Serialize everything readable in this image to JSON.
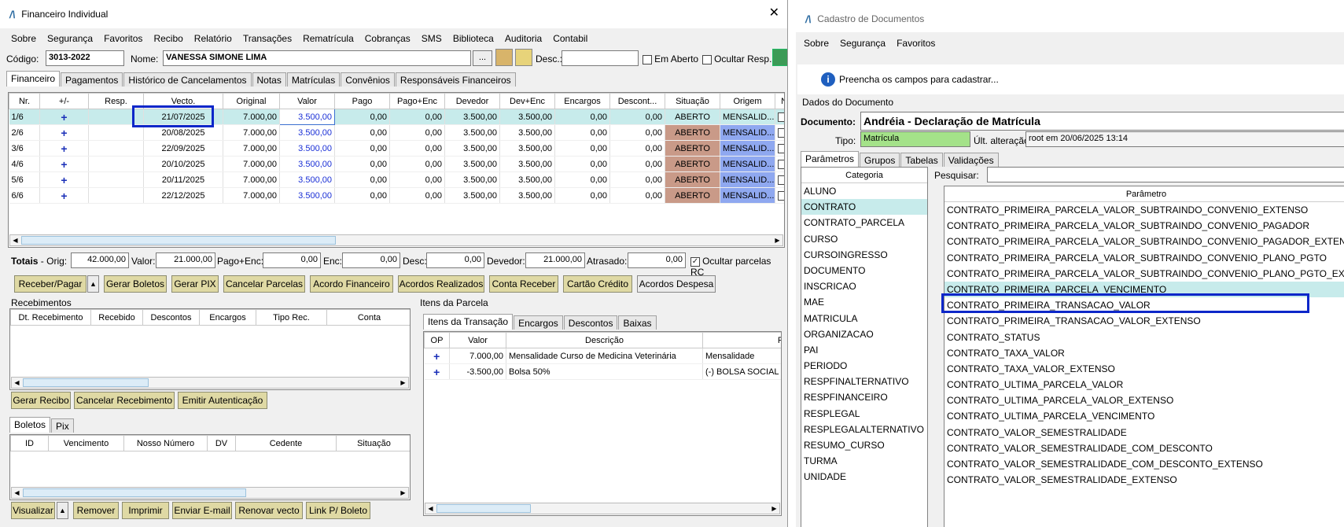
{
  "w1": {
    "title": "Financeiro Individual",
    "menu": [
      "Sobre",
      "Segurança",
      "Favoritos",
      "Recibo",
      "Relatório",
      "Transações",
      "Rematrícula",
      "Cobranças",
      "SMS",
      "Biblioteca",
      "Auditoria",
      "Contabil"
    ],
    "codigo_label": "Código:",
    "codigo": "3013-2022",
    "nome_label": "Nome:",
    "nome": "VANESSA SIMONE LIMA",
    "ellipsis": "...",
    "desc_label": "Desc.:",
    "em_aberto": "Em Aberto",
    "ocultar_resp": "Ocultar Resp.",
    "tabs": [
      "Financeiro",
      "Pagamentos",
      "Histórico de Cancelamentos",
      "Notas",
      "Matrículas",
      "Convênios",
      "Responsáveis Financeiros"
    ],
    "columns": [
      "Nr.",
      "+/-",
      "Resp.",
      "Vecto.",
      "Original",
      "Valor",
      "Pago",
      "Pago+Enc",
      "Devedor",
      "Dev+Enc",
      "Encargos",
      "Descont...",
      "Situação",
      "Origem",
      "NF"
    ],
    "rows": [
      {
        "nr": "1/6",
        "pm": "+",
        "resp": "",
        "vecto": "21/07/2025",
        "original": "7.000,00",
        "valor": "3.500,00",
        "pago": "0,00",
        "pagoenc": "0,00",
        "devedor": "3.500,00",
        "devenc": "3.500,00",
        "encargos": "0,00",
        "desc": "0,00",
        "sit": "ABERTO",
        "origem": "MENSALID..."
      },
      {
        "nr": "2/6",
        "pm": "+",
        "resp": "",
        "vecto": "20/08/2025",
        "original": "7.000,00",
        "valor": "3.500,00",
        "pago": "0,00",
        "pagoenc": "0,00",
        "devedor": "3.500,00",
        "devenc": "3.500,00",
        "encargos": "0,00",
        "desc": "0,00",
        "sit": "ABERTO",
        "origem": "MENSALID..."
      },
      {
        "nr": "3/6",
        "pm": "+",
        "resp": "",
        "vecto": "22/09/2025",
        "original": "7.000,00",
        "valor": "3.500,00",
        "pago": "0,00",
        "pagoenc": "0,00",
        "devedor": "3.500,00",
        "devenc": "3.500,00",
        "encargos": "0,00",
        "desc": "0,00",
        "sit": "ABERTO",
        "origem": "MENSALID..."
      },
      {
        "nr": "4/6",
        "pm": "+",
        "resp": "",
        "vecto": "20/10/2025",
        "original": "7.000,00",
        "valor": "3.500,00",
        "pago": "0,00",
        "pagoenc": "0,00",
        "devedor": "3.500,00",
        "devenc": "3.500,00",
        "encargos": "0,00",
        "desc": "0,00",
        "sit": "ABERTO",
        "origem": "MENSALID..."
      },
      {
        "nr": "5/6",
        "pm": "+",
        "resp": "",
        "vecto": "20/11/2025",
        "original": "7.000,00",
        "valor": "3.500,00",
        "pago": "0,00",
        "pagoenc": "0,00",
        "devedor": "3.500,00",
        "devenc": "3.500,00",
        "encargos": "0,00",
        "desc": "0,00",
        "sit": "ABERTO",
        "origem": "MENSALID..."
      },
      {
        "nr": "6/6",
        "pm": "+",
        "resp": "",
        "vecto": "22/12/2025",
        "original": "7.000,00",
        "valor": "3.500,00",
        "pago": "0,00",
        "pagoenc": "0,00",
        "devedor": "3.500,00",
        "devenc": "3.500,00",
        "encargos": "0,00",
        "desc": "0,00",
        "sit": "ABERTO",
        "origem": "MENSALID..."
      }
    ],
    "totais": {
      "label": "Totais",
      "orig_label": "- Orig:",
      "orig": "42.000,00",
      "valor_label": "Valor:",
      "valor": "21.000,00",
      "pagoenc_label": "Pago+Enc:",
      "pagoenc": "0,00",
      "enc_label": "Enc:",
      "enc": "0,00",
      "desc_label": "Desc:",
      "desc": "0,00",
      "devedor_label": "Devedor:",
      "devedor": "21.000,00",
      "atrasado_label": "Atrasado:",
      "atrasado": "0,00",
      "ocultar": "Ocultar parcelas RC"
    },
    "actions": [
      "Receber/Pagar",
      "Gerar Boletos",
      "Gerar PIX",
      "Cancelar Parcelas",
      "Acordo Financeiro",
      "Acordos Realizados",
      "Conta Receber",
      "Cartão Crédito",
      "Acordos Despesa"
    ],
    "recebimentos": {
      "title": "Recebimentos",
      "columns": [
        "Dt. Recebimento",
        "Recebido",
        "Descontos",
        "Encargos",
        "Tipo Rec.",
        "Conta"
      ],
      "buttons": [
        "Gerar Recibo",
        "Cancelar Recebimento",
        "Emitir Autenticação"
      ]
    },
    "boletos": {
      "tabs": [
        "Boletos",
        "Pix"
      ],
      "columns": [
        "ID",
        "Vencimento",
        "Nosso Número",
        "DV",
        "Cedente",
        "Situação"
      ],
      "buttons": [
        "Visualizar",
        "Remover",
        "Imprimir",
        "Enviar E-mail",
        "Renovar vecto",
        "Link P/ Boleto"
      ]
    },
    "itens": {
      "title": "Itens da Parcela",
      "tabs": [
        "Itens da Transação",
        "Encargos",
        "Descontos",
        "Baixas"
      ],
      "columns": [
        "OP",
        "Valor",
        "Descrição",
        "Plano"
      ],
      "rows": [
        {
          "op": "+",
          "valor": "7.000,00",
          "desc": "Mensalidade Curso de Medicina Veterinária",
          "plano": "Mensalidade"
        },
        {
          "op": "+",
          "valor": "-3.500,00",
          "desc": "Bolsa 50%",
          "plano": "(-) BOLSA SOCIAL"
        }
      ]
    }
  },
  "w2": {
    "title": "Cadastro de Documentos",
    "menu": [
      "Sobre",
      "Segurança",
      "Favoritos"
    ],
    "info": "Preencha os campos para cadastrar...",
    "dados_title": "Dados do Documento",
    "documento_label": "Documento:",
    "documento": "Andréia - Declaração de Matrícula",
    "tipo_label": "Tipo:",
    "tipo": "Matrícula",
    "alt_label": "Últ. alteração:",
    "alt": "root em 20/06/2025 13:14",
    "tabs": [
      "Parâmetros",
      "Grupos",
      "Tabelas",
      "Validações"
    ],
    "categoria_header": "Categoria",
    "pesquisar_label": "Pesquisar:",
    "parametro_header": "Parâmetro",
    "categorias": [
      "ALUNO",
      "CONTRATO",
      "CONTRATO_PARCELA",
      "CURSO",
      "CURSOINGRESSO",
      "DOCUMENTO",
      "INSCRICAO",
      "MAE",
      "MATRICULA",
      "ORGANIZACAO",
      "PAI",
      "PERIODO",
      "RESPFINALTERNATIVO",
      "RESPFINANCEIRO",
      "RESPLEGAL",
      "RESPLEGALALTERNATIVO",
      "RESUMO_CURSO",
      "TURMA",
      "UNIDADE"
    ],
    "parametros": [
      "CONTRATO_PRIMEIRA_PARCELA_VALOR_SUBTRAINDO_CONVENIO_EXTENSO",
      "CONTRATO_PRIMEIRA_PARCELA_VALOR_SUBTRAINDO_CONVENIO_PAGADOR",
      "CONTRATO_PRIMEIRA_PARCELA_VALOR_SUBTRAINDO_CONVENIO_PAGADOR_EXTENSO",
      "CONTRATO_PRIMEIRA_PARCELA_VALOR_SUBTRAINDO_CONVENIO_PLANO_PGTO",
      "CONTRATO_PRIMEIRA_PARCELA_VALOR_SUBTRAINDO_CONVENIO_PLANO_PGTO_EXTENSO",
      "CONTRATO_PRIMEIRA_PARCELA_VENCIMENTO",
      "CONTRATO_PRIMEIRA_TRANSACAO_VALOR",
      "CONTRATO_PRIMEIRA_TRANSACAO_VALOR_EXTENSO",
      "CONTRATO_STATUS",
      "CONTRATO_TAXA_VALOR",
      "CONTRATO_TAXA_VALOR_EXTENSO",
      "CONTRATO_ULTIMA_PARCELA_VALOR",
      "CONTRATO_ULTIMA_PARCELA_VALOR_EXTENSO",
      "CONTRATO_ULTIMA_PARCELA_VENCIMENTO",
      "CONTRATO_VALOR_SEMESTRALIDADE",
      "CONTRATO_VALOR_SEMESTRALIDADE_COM_DESCONTO",
      "CONTRATO_VALOR_SEMESTRALIDADE_COM_DESCONTO_EXTENSO",
      "CONTRATO_VALOR_SEMESTRALIDADE_EXTENSO"
    ]
  }
}
